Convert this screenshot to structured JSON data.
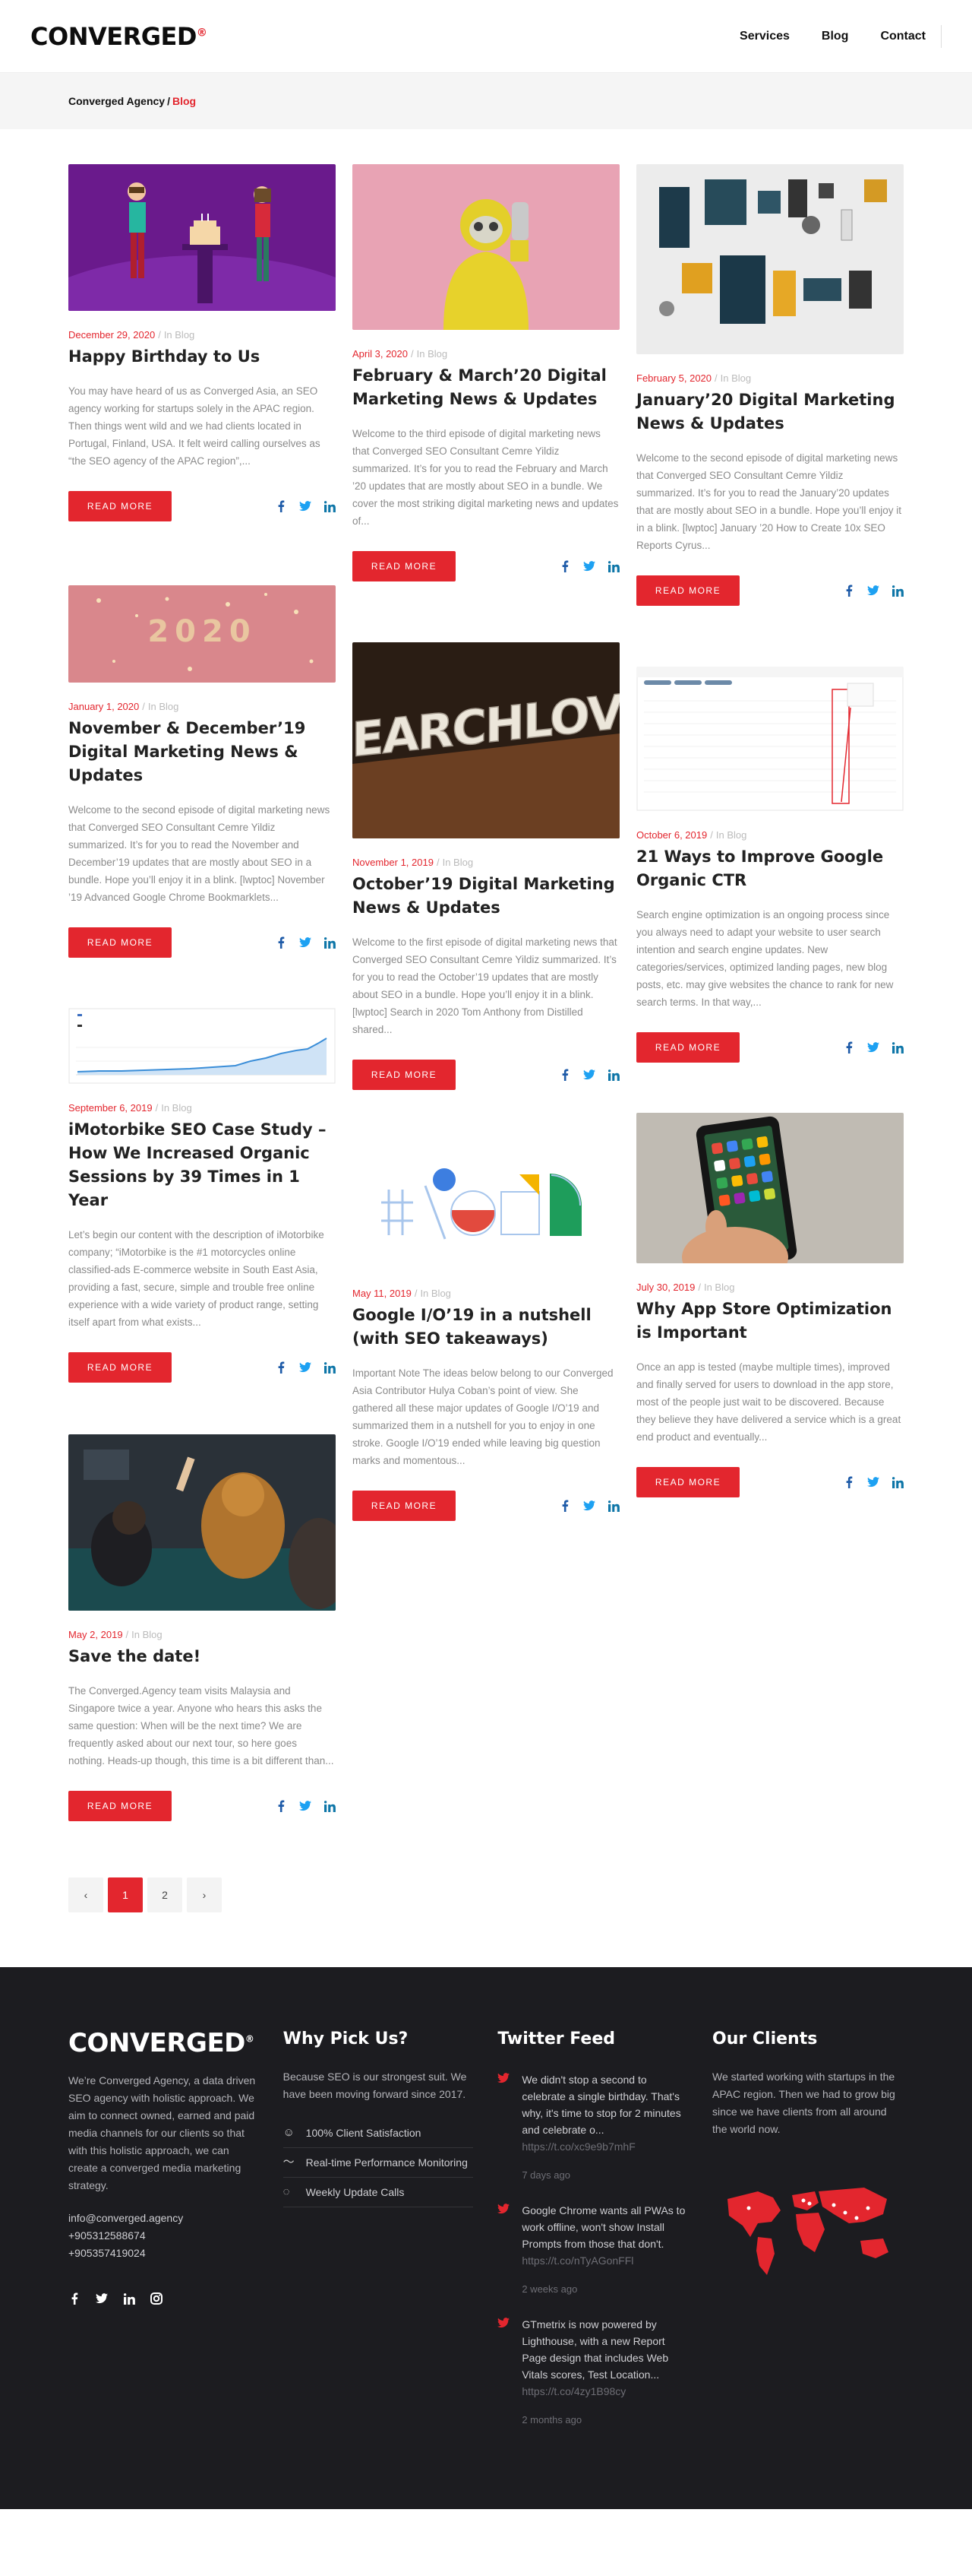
{
  "header": {
    "logo": "CONVERGED",
    "logo_mark": "®",
    "nav": [
      "Services",
      "Blog",
      "Contact"
    ]
  },
  "breadcrumb": {
    "home": "Converged Agency",
    "separator": "/",
    "current": "Blog"
  },
  "read_more_label": "READ MORE",
  "in_prefix": "In Blog",
  "posts": [
    {
      "date": "December 29, 2020",
      "category": "In Blog",
      "title": "Happy Birthday to Us",
      "excerpt": "You may have heard of us as Converged Asia, an SEO agency working for startups solely in the APAC region.   Then things went wild and we had clients located in Portugal, Finland, USA. It felt weird calling ourselves as “the SEO agency of the APAC region”,..."
    },
    {
      "date": "April 3, 2020",
      "category": "In Blog",
      "title": "February & March’20 Digital Marketing News & Updates",
      "excerpt": "Welcome to the third episode of digital marketing news that Converged SEO Consultant Cemre Yildiz summarized. It’s for you to read the  February and March ’20 updates that are mostly about SEO in a bundle. We cover the most striking digital marketing news and updates of..."
    },
    {
      "date": "February 5, 2020",
      "category": "In Blog",
      "title": "January’20 Digital Marketing News & Updates",
      "excerpt": "Welcome to the second episode of digital marketing news that Converged SEO Consultant Cemre Yildiz summarized. It’s for you to read the January’20 updates that are mostly about SEO in a bundle. Hope you’ll enjoy it in a blink. [lwptoc]   January ’20  How to Create 10x SEO Reports     Cyrus..."
    },
    {
      "date": "January 1, 2020",
      "category": "In Blog",
      "title": "November & December’19 Digital Marketing News & Updates",
      "excerpt": "Welcome to the second episode of digital marketing news that Converged SEO Consultant Cemre Yildiz summarized. It’s for you to read the November and December’19 updates that are mostly about SEO in a bundle. Hope you’ll enjoy it in a blink. [lwptoc]   November ’19   Advanced Google Chrome Bookmarklets..."
    },
    {
      "date": "November 1, 2019",
      "category": "In Blog",
      "title": "October’19 Digital Marketing News & Updates",
      "excerpt": "Welcome to the first episode of digital marketing news that Converged SEO Consultant Cemre Yildiz summarized. It’s for you to read the October’19 updates that are mostly about SEO in a bundle. Hope you’ll enjoy it in a blink. [lwptoc]   Search in 2020  Tom Anthony from Distilled shared..."
    },
    {
      "date": "October 6, 2019",
      "category": "In Blog",
      "title": "21 Ways to Improve Google Organic CTR",
      "excerpt": "Search engine optimization is an ongoing process since you always need to adapt your website to user search intention and search engine updates.    New categories/services, optimized landing pages, new blog posts, etc. may give websites the chance to rank for new search terms. In that way,..."
    },
    {
      "date": "September 6, 2019",
      "category": "In Blog",
      "title": "iMotorbike SEO Case Study – How We Increased Organic Sessions by 39 Times in 1 Year",
      "excerpt": "Let’s begin our content with the description of iMotorbike company; “iMotorbike is the #1 motorcycles online classified-ads E-commerce website in South East Asia, providing a fast, secure, simple and trouble free online experience with a wide variety of product range, setting itself apart from what exists..."
    },
    {
      "date": "May 11, 2019",
      "category": "In Blog",
      "title": "Google I/O’19 in a nutshell (with SEO takeaways)",
      "excerpt": "  Important Note   The ideas below belong to our Converged Asia Contributor Hulya Coban’s point of view. She gathered all these major updates of Google I/O’19 and summarized them in a nutshell for you to enjoy in one stroke.   Google I/O’19 ended while leaving big question marks and momentous..."
    },
    {
      "date": "July 30, 2019",
      "category": "In Blog",
      "title": "Why App Store Optimization is Important",
      "excerpt": "  Once an app is tested (maybe multiple times), improved and finally served for users to download in the app store, most of the people just wait to be discovered. Because they believe they have delivered a service which is a great end product and eventually..."
    },
    {
      "date": "May 2, 2019",
      "category": "In Blog",
      "title": "Save the date!",
      "excerpt": "The Converged.Agency team visits Malaysia and Singapore twice a year. Anyone who hears this asks the same question: When will be the next time? We are frequently asked about our next tour, so here goes nothing.   Heads-up though, this time is a bit different than..."
    }
  ],
  "pagination": [
    "‹",
    "1",
    "2",
    "›"
  ],
  "footer": {
    "about": {
      "logo": "CONVERGED",
      "logo_mark": "®",
      "text": "We’re Converged Agency, a data driven SEO agency with holistic approach. We aim to connect owned, earned and paid media channels for our clients so that with this holistic approach, we can create a converged media marketing strategy.",
      "email": "info@converged.agency",
      "phone1": "+905312588674",
      "phone2": "+905357419024"
    },
    "why": {
      "title": "Why Pick Us?",
      "text": "Because SEO is our strongest suit. We have been moving forward since 2017.",
      "items": [
        "100% Client Satisfaction",
        "Real-time Performance Monitoring",
        "Weekly Update Calls"
      ]
    },
    "twitter": {
      "title": "Twitter Feed",
      "tweets": [
        {
          "text": "We didn't stop a second to celebrate a single birthday. That's why, it's time to stop for 2 minutes and celebrate o...",
          "link": "https://t.co/xc9e9b7mhF",
          "time": "7 days ago"
        },
        {
          "text": "Google Chrome wants all PWAs to work offline, won't show Install Prompts from those that don't.",
          "link": "https://t.co/nTyAGonFFl",
          "time": "2 weeks ago"
        },
        {
          "text": "GTmetrix is now powered by Lighthouse, with a new Report Page design that includes Web Vitals scores, Test Location...",
          "link": "https://t.co/4zy1B98cy",
          "time": "2 months ago"
        }
      ]
    },
    "clients": {
      "title": "Our Clients",
      "text": "We started working with startups in the APAC region. Then we had to grow big since we have clients from all around the world now."
    },
    "colors": {
      "bg": "#1c1c20",
      "accent": "#e3262e"
    }
  },
  "colors": {
    "accent": "#e3262e",
    "facebook": "#1e5ba8",
    "twitter": "#1da1f2",
    "linkedin": "#0e76a8"
  }
}
